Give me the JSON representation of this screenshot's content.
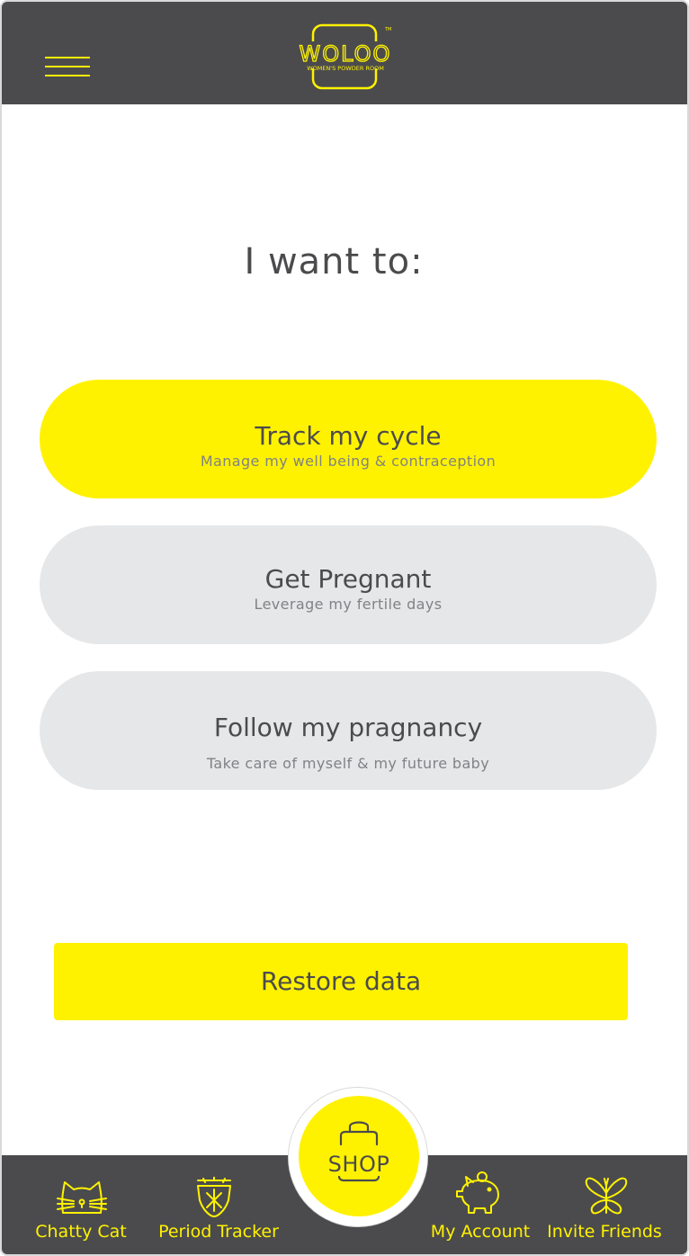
{
  "header": {
    "menu_icon": "hamburger-menu-icon",
    "logo_text": "WOLOO",
    "logo_tagline": "WOMEN'S POWDER ROOM",
    "logo_tm": "TM"
  },
  "main": {
    "heading": "I want to:",
    "options": [
      {
        "title": "Track my cycle",
        "subtitle": "Manage my well being & contraception",
        "selected": true
      },
      {
        "title": "Get Pregnant",
        "subtitle": "Leverage my fertile days",
        "selected": false
      },
      {
        "title": "Follow my pragnancy",
        "subtitle": "Take care of myself & my future baby",
        "selected": false
      }
    ],
    "restore_label": "Restore data"
  },
  "bottom_nav": {
    "items": [
      {
        "label": "Chatty Cat",
        "icon": "cat-icon"
      },
      {
        "label": "Period Tracker",
        "icon": "period-tracker-icon"
      },
      {
        "label": "My Account",
        "icon": "piggy-bank-icon"
      },
      {
        "label": "Invite Friends",
        "icon": "butterfly-icon"
      }
    ],
    "shop_label": "SHOP",
    "shop_icon": "shopping-bag-icon"
  },
  "colors": {
    "accent": "#fff200",
    "bar_background": "#4b4b4d",
    "option_inactive": "#e6e7e8",
    "text_dark": "#4b4b4d",
    "text_muted": "#808285"
  }
}
